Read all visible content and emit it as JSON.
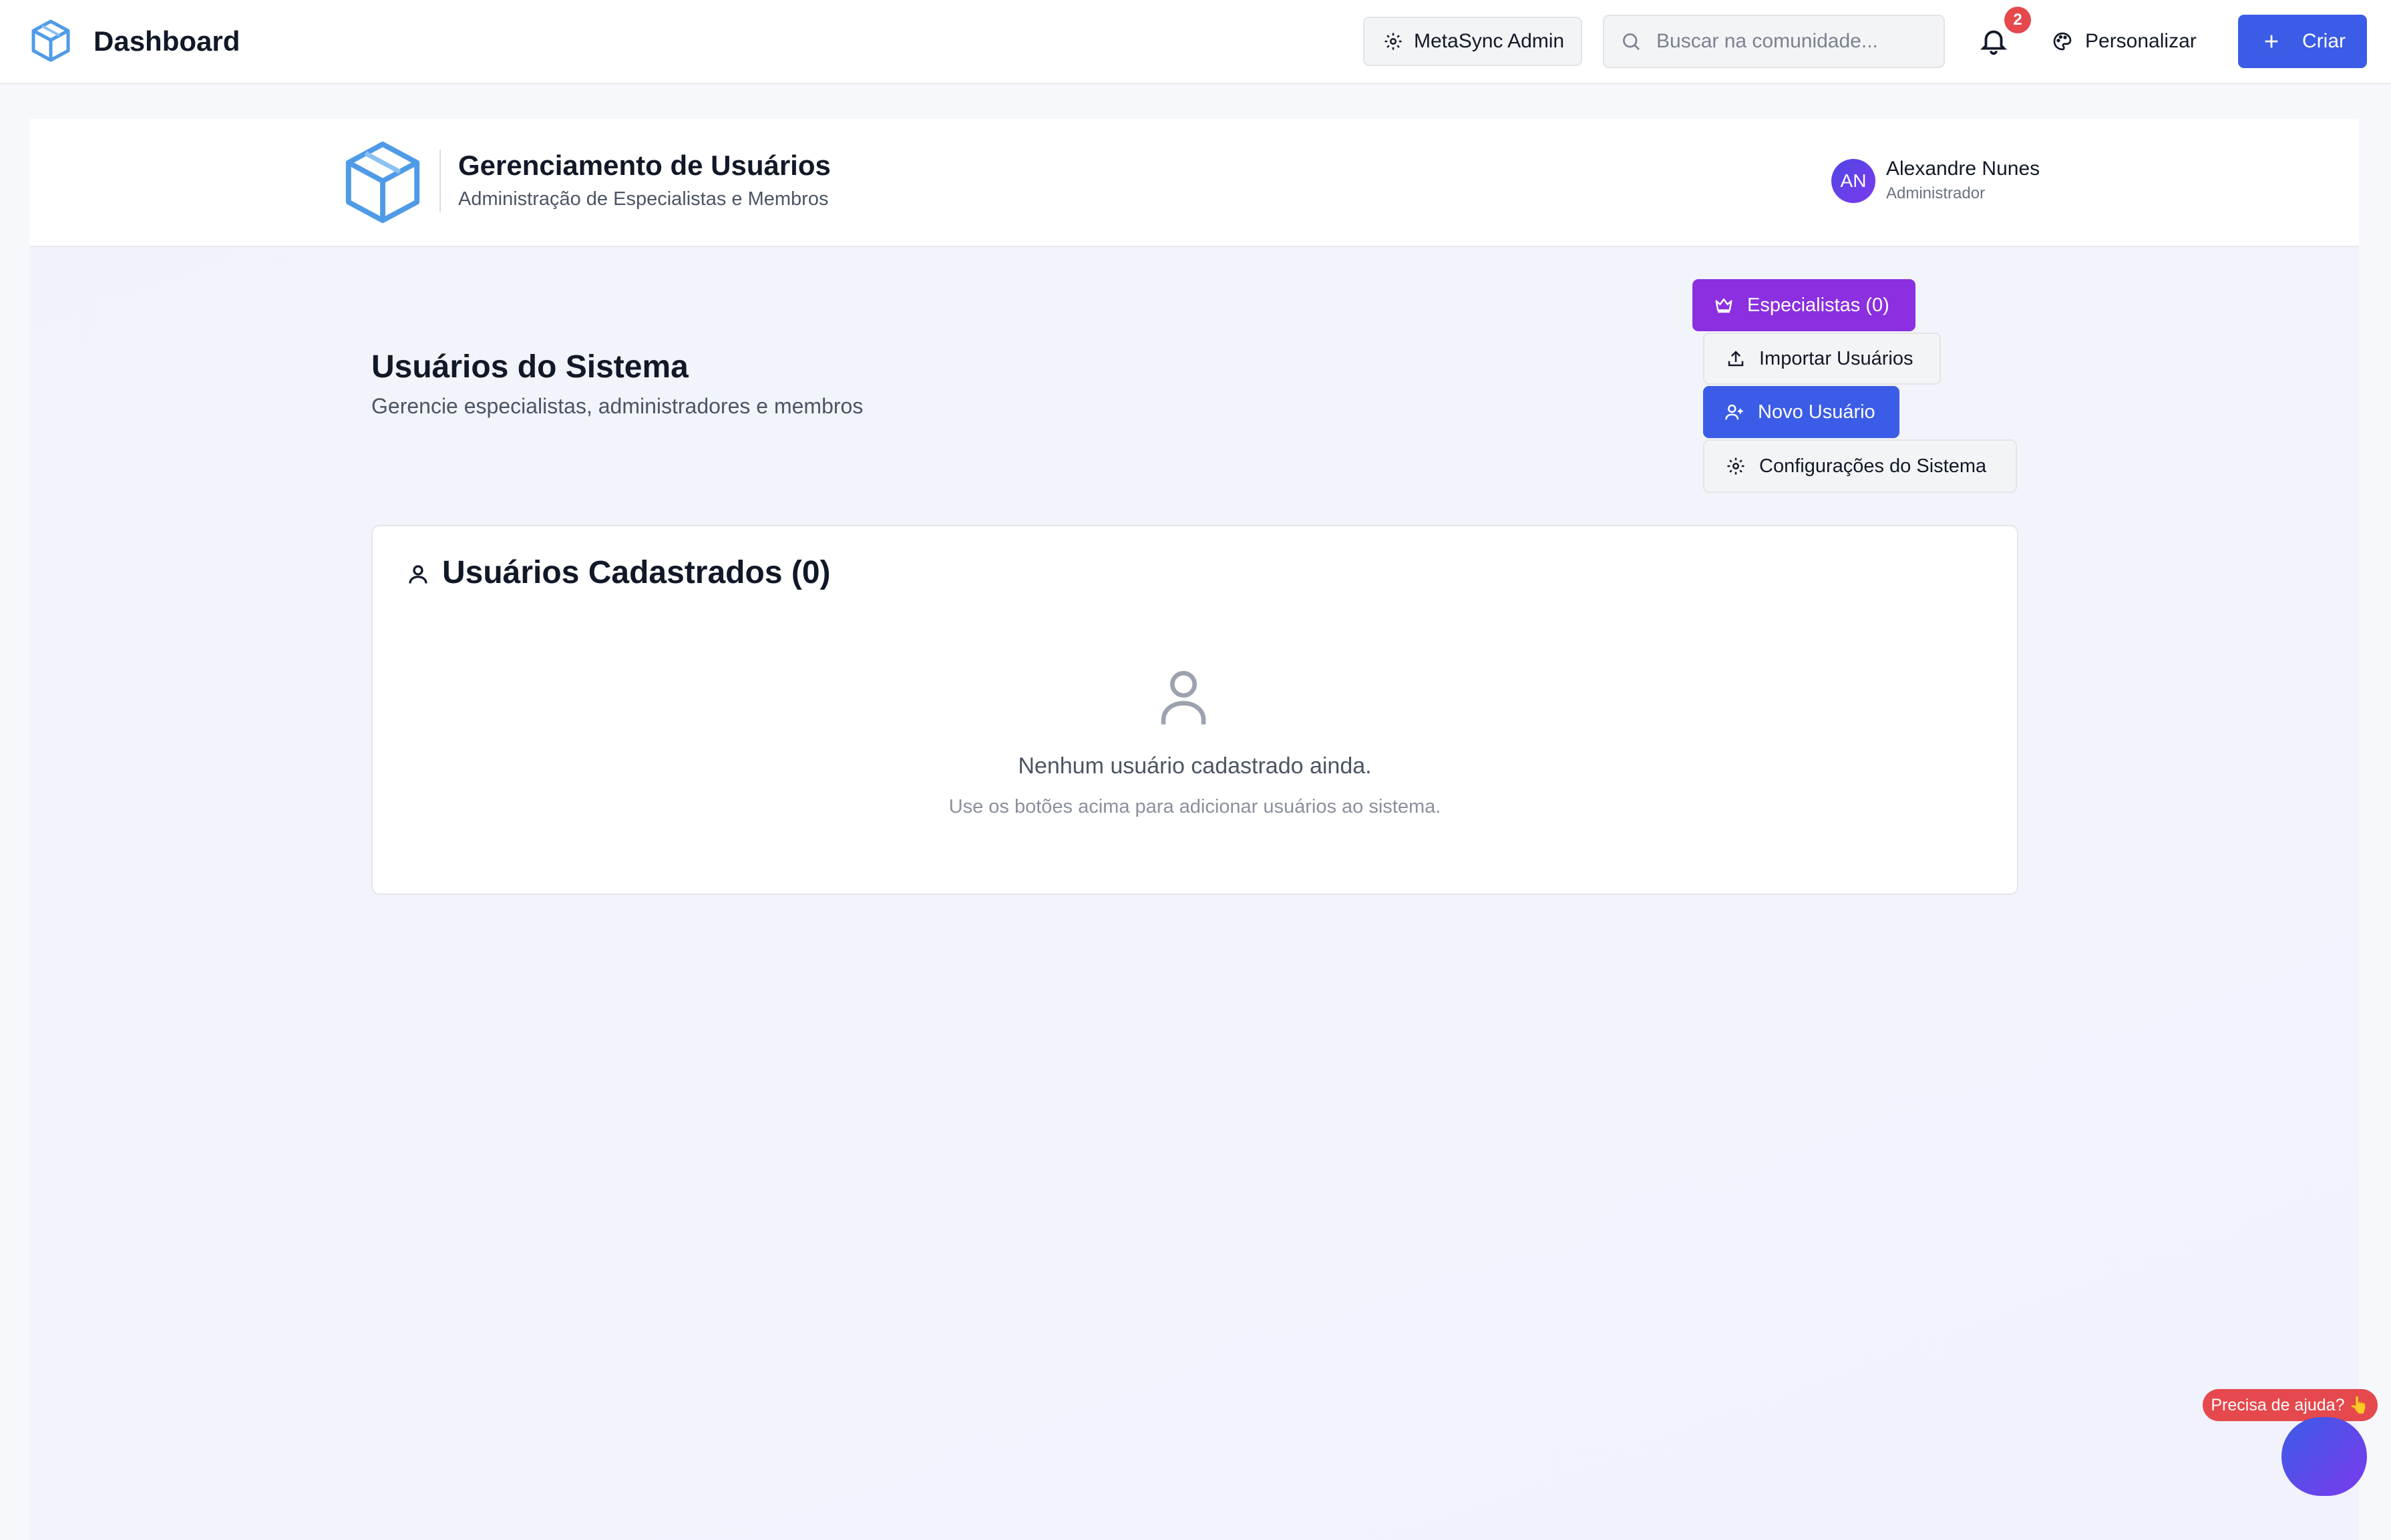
{
  "topbar": {
    "title": "Dashboard",
    "admin_label": "MetaSync Admin",
    "search_placeholder": "Buscar na comunidade...",
    "notifications_count": "2",
    "personalize_label": "Personalizar",
    "create_label": "Criar"
  },
  "header": {
    "title": "Gerenciamento de Usuários",
    "subtitle": "Administração de Especialistas e Membros",
    "user": {
      "initials": "AN",
      "name": "Alexandre Nunes",
      "role": "Administrador"
    }
  },
  "page": {
    "title": "Usuários do Sistema",
    "subtitle": "Gerencie especialistas, administradores e membros",
    "actions": {
      "specialists": "Especialistas (0)",
      "import": "Importar Usuários",
      "new_user": "Novo Usuário",
      "settings": "Configurações do Sistema"
    }
  },
  "users_card": {
    "title": "Usuários Cadastrados (0)",
    "empty_text": "Nenhum usuário cadastrado ainda.",
    "empty_hint": "Use os botões acima para adicionar usuários ao sistema."
  },
  "help": {
    "label": "Precisa de ajuda?",
    "emoji": "👆"
  },
  "colors": {
    "primary": "#3b5ce6",
    "specialists": "#8b2fe0",
    "badge": "#e5484d",
    "logo": "#4f9be8"
  }
}
